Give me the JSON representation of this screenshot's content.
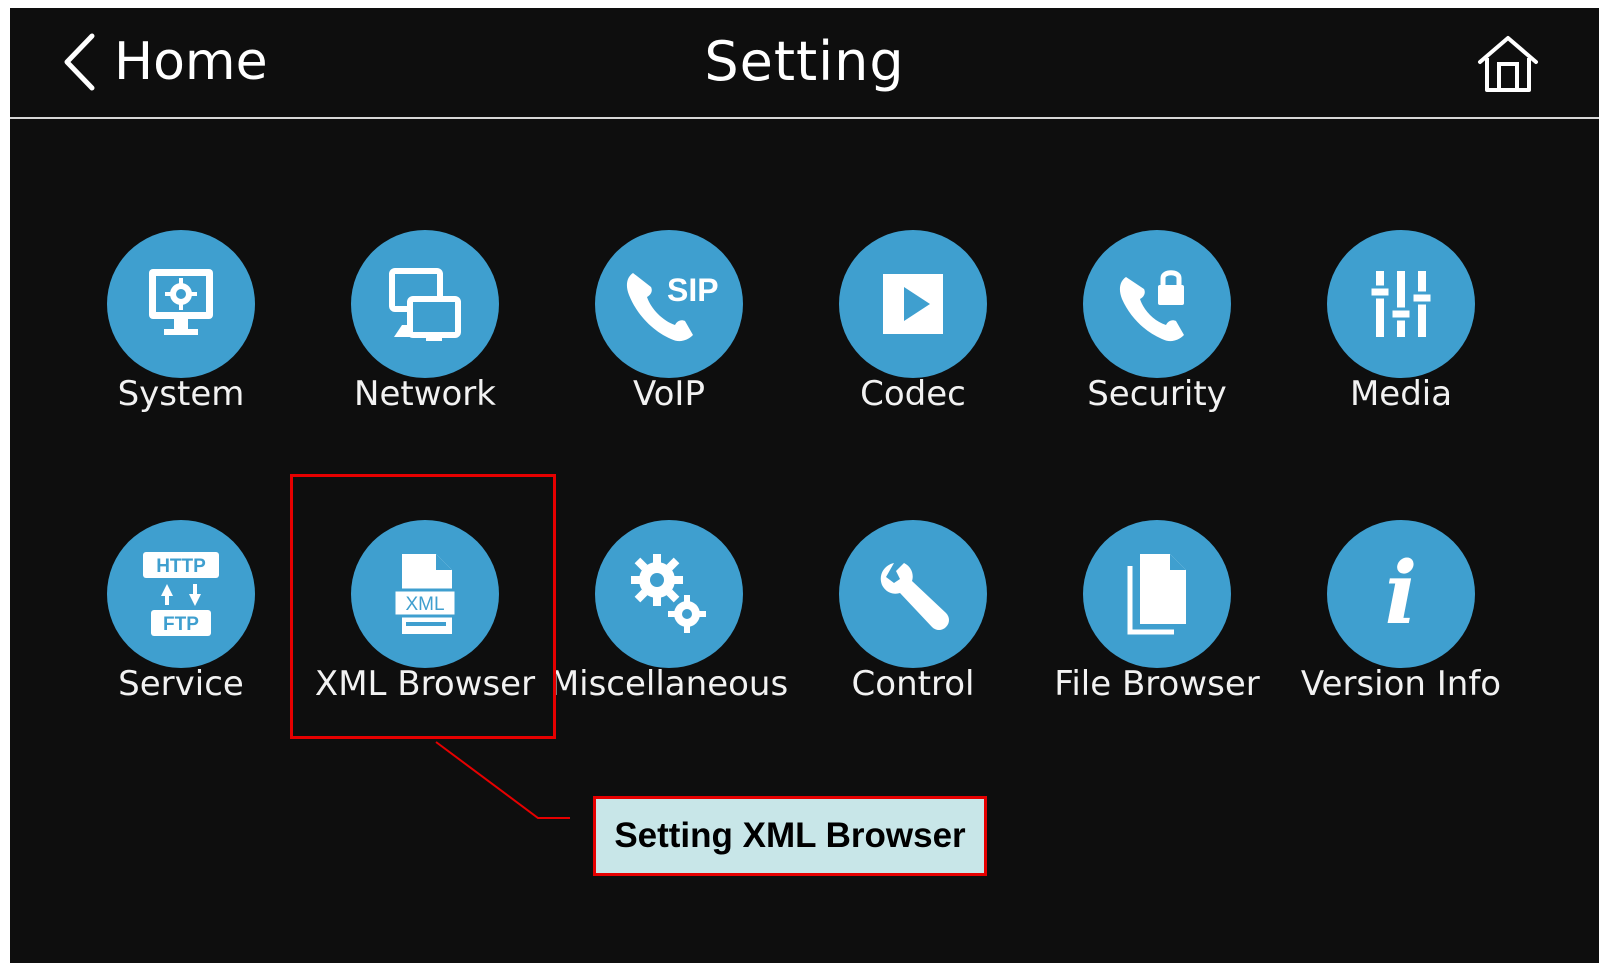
{
  "header": {
    "back_label": "Home",
    "title": "Setting",
    "back_icon": "chevron-left-icon",
    "home_icon": "home-icon"
  },
  "colors": {
    "background": "#0e0e0e",
    "icon_circle": "#3f9fcf",
    "text": "#f2f2f2",
    "highlight": "#e60000",
    "callout_fill": "#c8e6e8"
  },
  "menu": {
    "items": [
      {
        "label": "System",
        "icon": "monitor-gear-icon"
      },
      {
        "label": "Network",
        "icon": "network-monitors-icon"
      },
      {
        "label": "VoIP",
        "icon": "sip-phone-icon"
      },
      {
        "label": "Codec",
        "icon": "play-icon"
      },
      {
        "label": "Security",
        "icon": "phone-lock-icon"
      },
      {
        "label": "Media",
        "icon": "sliders-icon"
      },
      {
        "label": "Service",
        "icon": "http-ftp-icon",
        "http": "HTTP",
        "ftp": "FTP"
      },
      {
        "label": "XML Browser",
        "icon": "xml-file-icon",
        "badge": "XML"
      },
      {
        "label": "Miscellaneous",
        "icon": "gears-icon"
      },
      {
        "label": "Control",
        "icon": "wrench-icon"
      },
      {
        "label": "File Browser",
        "icon": "files-icon"
      },
      {
        "label": "Version Info",
        "icon": "info-icon",
        "glyph": "i"
      }
    ]
  },
  "annotation": {
    "callout_text": "Setting XML Browser",
    "highlighted_item": "XML Browser"
  }
}
